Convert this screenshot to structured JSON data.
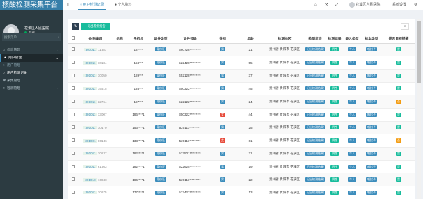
{
  "app": {
    "title": "核酸检测采集平台"
  },
  "user": {
    "name": "花溪区人民医院",
    "status": "在线"
  },
  "sidebar": {
    "search_placeholder": "搜索菜单",
    "items": [
      {
        "label": "信息管理",
        "icon": "home-icon"
      },
      {
        "label": "用户管理",
        "icon": "user-icon"
      },
      {
        "label": "用户管理",
        "icon": "circle-icon"
      },
      {
        "label": "用户检测记录",
        "icon": "circle-icon"
      },
      {
        "label": "采集管理",
        "icon": "gear-icon"
      },
      {
        "label": "检测管理",
        "icon": "list-icon"
      }
    ]
  },
  "header": {
    "tab1": "用户检测记录",
    "tab2": "个人资料",
    "account": "花溪区人民医院",
    "settings": "系统设置"
  },
  "toolbar": {
    "refresh_icon": "refresh-icon",
    "export_label": "导出检测报告",
    "search_icon": "search-icon"
  },
  "table": {
    "headers": [
      "条形编码",
      "名称",
      "手机号",
      "证件类型",
      "证件号码",
      "性别",
      "年龄",
      "检测地区",
      "检测状态",
      "检测结果",
      "录入类型",
      "标本类型",
      "是否日程提醒"
    ],
    "rows": [
      {
        "code": "301011",
        "code2": "11887",
        "name": "",
        "phone": "187***",
        "idtype": "身份证",
        "idnum": "360728*********",
        "gender": "男",
        "gcolor": "#3c8dbc",
        "age": "21",
        "region": "贵州省 贵阳市 花溪区",
        "status": "已出检测结果",
        "result": "阴性",
        "entry": "个人",
        "sample": "咽拭子",
        "remind": "是",
        "rcolor": "#18bc9c"
      },
      {
        "code": "301011",
        "code2": "10184",
        "name": "",
        "phone": "158***",
        "idtype": "身份证",
        "idnum": "522428*********",
        "gender": "男",
        "gcolor": "#3c8dbc",
        "age": "55",
        "region": "贵州省 贵阳市 花溪区",
        "status": "已出检测结果",
        "result": "阴性",
        "entry": "个人",
        "sample": "咽拭子",
        "remind": "是",
        "rcolor": "#18bc9c"
      },
      {
        "code": "301011",
        "code2": "10050",
        "name": "",
        "phone": "189***",
        "idtype": "身份证",
        "idnum": "452128*********",
        "gender": "男",
        "gcolor": "#3c8dbc",
        "age": "37",
        "region": "贵州省 贵阳市 花溪区",
        "status": "已出检测结果",
        "result": "阴性",
        "entry": "个人",
        "sample": "咽拭子",
        "remind": "是",
        "rcolor": "#18bc9c"
      },
      {
        "code": "301011",
        "code2": "75615",
        "name": "",
        "phone": "135***",
        "idtype": "身份证",
        "idnum": "350322*********",
        "gender": "男",
        "gcolor": "#3c8dbc",
        "age": "45",
        "region": "贵州省 贵阳市 花溪区",
        "status": "已出检测结果",
        "result": "阴性",
        "entry": "个人",
        "sample": "咽拭子",
        "remind": "是",
        "rcolor": "#18bc9c"
      },
      {
        "code": "301011",
        "code2": "32764",
        "name": "",
        "phone": "187***",
        "idtype": "身份证",
        "idnum": "522122*********",
        "gender": "男",
        "gcolor": "#3c8dbc",
        "age": "24",
        "region": "贵州省 贵阳市 花溪区",
        "status": "已出检测结果",
        "result": "阴性",
        "entry": "个人",
        "sample": "咽拭子",
        "remind": "否",
        "rcolor": "#f39c12"
      },
      {
        "code": "301011",
        "code2": "13007",
        "name": "",
        "phone": "186****1",
        "idtype": "身份证",
        "idnum": "350322*********",
        "gender": "女",
        "gcolor": "#e74c3c",
        "age": "44",
        "region": "贵州省 贵阳市 花溪区",
        "status": "已出检测结果",
        "result": "阴性",
        "entry": "个人",
        "sample": "咽拭子",
        "remind": "是",
        "rcolor": "#18bc9c"
      },
      {
        "code": "301011",
        "code2": "10170",
        "name": "",
        "phone": "153****1",
        "idtype": "身份证",
        "idnum": "520111*********",
        "gender": "男",
        "gcolor": "#3c8dbc",
        "age": "25",
        "region": "贵州省 贵阳市 花溪区",
        "status": "已出检测结果",
        "result": "阴性",
        "entry": "个人",
        "sample": "咽拭子",
        "remind": "是",
        "rcolor": "#18bc9c"
      },
      {
        "code": "301001",
        "code2": "80136",
        "name": "",
        "phone": "133****1",
        "idtype": "身份证",
        "idnum": "520111*********",
        "gender": "女",
        "gcolor": "#e74c3c",
        "age": "61",
        "region": "贵州省 贵阳市 花溪区",
        "status": "已出检测结果",
        "result": "阴性",
        "entry": "个人",
        "sample": "咽拭子",
        "remind": "否",
        "rcolor": "#f39c12"
      },
      {
        "code": "301011",
        "code2": "10137",
        "name": "",
        "phone": "182****1",
        "idtype": "身份证",
        "idnum": "522501*********",
        "gender": "男",
        "gcolor": "#3c8dbc",
        "age": "21",
        "region": "贵州省 贵阳市 花溪区",
        "status": "已出检测结果",
        "result": "阴性",
        "entry": "个人",
        "sample": "咽拭子",
        "remind": "是",
        "rcolor": "#18bc9c"
      },
      {
        "code": "301011",
        "code2": "61563",
        "name": "",
        "phone": "182****1",
        "idtype": "身份证",
        "idnum": "522625*********",
        "gender": "男",
        "gcolor": "#3c8dbc",
        "age": "19",
        "region": "贵州省 贵阳市 花溪区",
        "status": "已出检测结果",
        "result": "阴性",
        "entry": "个人",
        "sample": "咽拭子",
        "remind": "是",
        "rcolor": "#18bc9c"
      },
      {
        "code": "301010",
        "code2": "10680",
        "name": "",
        "phone": "186****1",
        "idtype": "身份证",
        "idnum": "520111*********",
        "gender": "男",
        "gcolor": "#3c8dbc",
        "age": "22",
        "region": "贵州省 贵阳市 花溪区",
        "status": "已出检测结果",
        "result": "阴性",
        "entry": "个人",
        "sample": "咽拭子",
        "remind": "是",
        "rcolor": "#18bc9c"
      },
      {
        "code": "301011",
        "code2": "10675",
        "name": "",
        "phone": "177****1",
        "idtype": "身份证",
        "idnum": "522422*********",
        "gender": "男",
        "gcolor": "#3c8dbc",
        "age": "13",
        "region": "贵州省 贵阳市 花溪区",
        "status": "已出检测结果",
        "result": "阴性",
        "entry": "个人",
        "sample": "咽拭子",
        "remind": "是",
        "rcolor": "#18bc9c"
      }
    ]
  }
}
